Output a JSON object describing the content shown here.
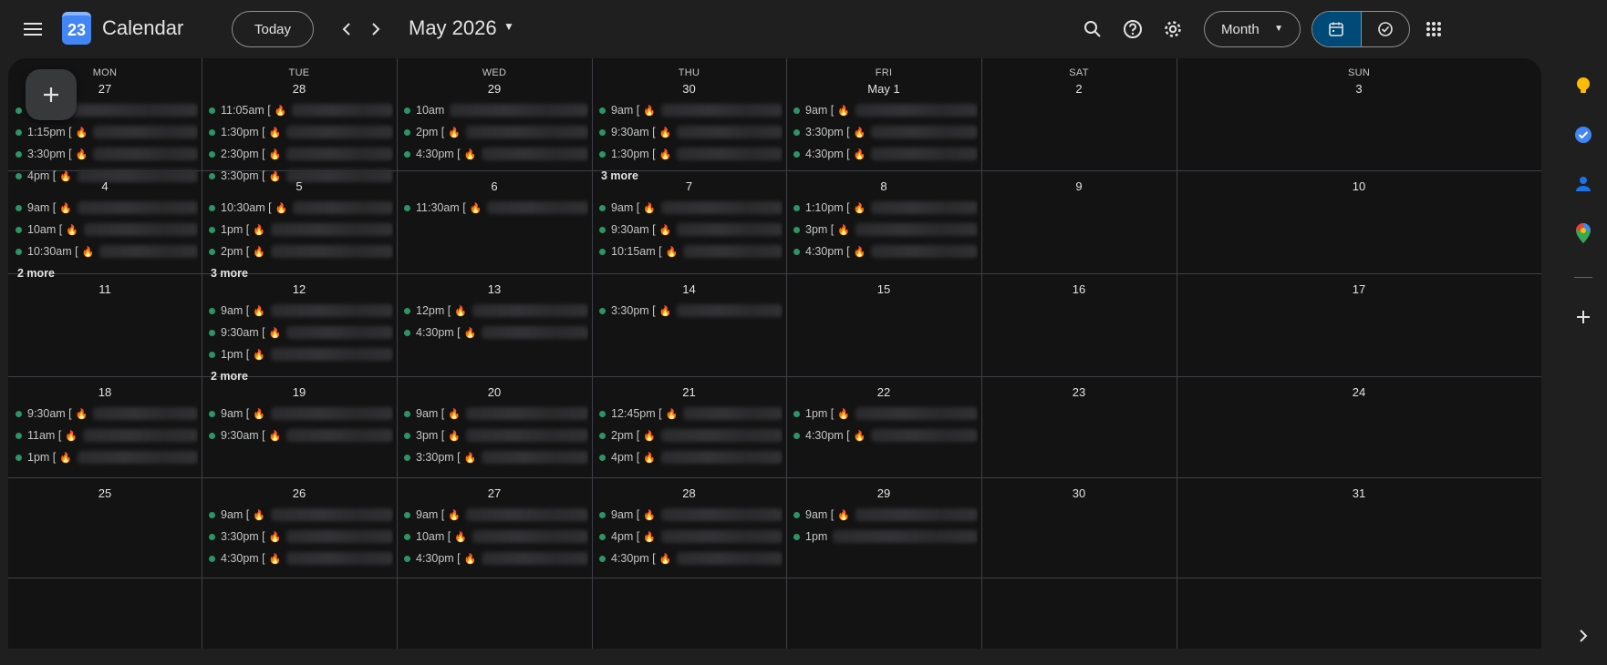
{
  "header": {
    "logo_text": "23",
    "app_title": "Calendar",
    "today_label": "Today",
    "period_title": "May 2026",
    "view_label": "Month"
  },
  "weekday_labels": [
    "MON",
    "TUE",
    "WED",
    "THU",
    "FRI",
    "SAT",
    "SUN"
  ],
  "more_template": "more",
  "weeks": [
    [
      {
        "day": "27",
        "events": [
          {
            "t": ""
          },
          {
            "t": "1:15pm ["
          },
          {
            "t": "3:30pm ["
          },
          {
            "t": "4pm ["
          }
        ],
        "more": ""
      },
      {
        "day": "28",
        "events": [
          {
            "t": "11:05am ["
          },
          {
            "t": "1:30pm ["
          },
          {
            "t": "2:30pm ["
          },
          {
            "t": "3:30pm ["
          }
        ],
        "more": ""
      },
      {
        "day": "29",
        "events": [
          {
            "t": "10am"
          },
          {
            "t": "2pm ["
          },
          {
            "t": "4:30pm ["
          }
        ],
        "more": ""
      },
      {
        "day": "30",
        "events": [
          {
            "t": "9am ["
          },
          {
            "t": "9:30am ["
          },
          {
            "t": "1:30pm ["
          }
        ],
        "more": "3 more"
      },
      {
        "day": "May 1",
        "events": [
          {
            "t": "9am ["
          },
          {
            "t": "3:30pm ["
          },
          {
            "t": "4:30pm ["
          }
        ],
        "more": ""
      },
      {
        "day": "2",
        "events": [],
        "more": ""
      },
      {
        "day": "3",
        "events": [],
        "more": ""
      }
    ],
    [
      {
        "day": "4",
        "events": [
          {
            "t": "9am ["
          },
          {
            "t": "10am ["
          },
          {
            "t": "10:30am ["
          }
        ],
        "more": "2 more"
      },
      {
        "day": "5",
        "events": [
          {
            "t": "10:30am ["
          },
          {
            "t": "1pm ["
          },
          {
            "t": "2pm ["
          }
        ],
        "more": "3 more"
      },
      {
        "day": "6",
        "events": [
          {
            "t": "11:30am ["
          }
        ],
        "more": ""
      },
      {
        "day": "7",
        "events": [
          {
            "t": "9am ["
          },
          {
            "t": "9:30am ["
          },
          {
            "t": "10:15am ["
          }
        ],
        "more": ""
      },
      {
        "day": "8",
        "events": [
          {
            "t": "1:10pm ["
          },
          {
            "t": "3pm ["
          },
          {
            "t": "4:30pm ["
          }
        ],
        "more": ""
      },
      {
        "day": "9",
        "events": [],
        "more": ""
      },
      {
        "day": "10",
        "events": [],
        "more": ""
      }
    ],
    [
      {
        "day": "11",
        "events": [],
        "more": ""
      },
      {
        "day": "12",
        "events": [
          {
            "t": "9am ["
          },
          {
            "t": "9:30am ["
          },
          {
            "t": "1pm ["
          }
        ],
        "more": "2 more"
      },
      {
        "day": "13",
        "events": [
          {
            "t": "12pm ["
          },
          {
            "t": "4:30pm ["
          }
        ],
        "more": ""
      },
      {
        "day": "14",
        "events": [
          {
            "t": "3:30pm ["
          }
        ],
        "more": ""
      },
      {
        "day": "15",
        "events": [],
        "more": ""
      },
      {
        "day": "16",
        "events": [],
        "more": ""
      },
      {
        "day": "17",
        "events": [],
        "more": ""
      }
    ],
    [
      {
        "day": "18",
        "events": [
          {
            "t": "9:30am ["
          },
          {
            "t": "11am ["
          },
          {
            "t": "1pm ["
          }
        ],
        "more": ""
      },
      {
        "day": "19",
        "events": [
          {
            "t": "9am ["
          },
          {
            "t": "9:30am ["
          }
        ],
        "more": ""
      },
      {
        "day": "20",
        "events": [
          {
            "t": "9am ["
          },
          {
            "t": "3pm ["
          },
          {
            "t": "3:30pm ["
          }
        ],
        "more": ""
      },
      {
        "day": "21",
        "events": [
          {
            "t": "12:45pm ["
          },
          {
            "t": "2pm ["
          },
          {
            "t": "4pm ["
          }
        ],
        "more": ""
      },
      {
        "day": "22",
        "events": [
          {
            "t": "1pm ["
          },
          {
            "t": "4:30pm ["
          }
        ],
        "more": ""
      },
      {
        "day": "23",
        "events": [],
        "more": ""
      },
      {
        "day": "24",
        "events": [],
        "more": ""
      }
    ],
    [
      {
        "day": "25",
        "events": [],
        "more": ""
      },
      {
        "day": "26",
        "events": [
          {
            "t": "9am ["
          },
          {
            "t": "3:30pm ["
          },
          {
            "t": "4:30pm ["
          }
        ],
        "more": ""
      },
      {
        "day": "27",
        "events": [
          {
            "t": "9am ["
          },
          {
            "t": "10am ["
          },
          {
            "t": "4:30pm ["
          }
        ],
        "more": ""
      },
      {
        "day": "28",
        "events": [
          {
            "t": "9am ["
          },
          {
            "t": "4pm ["
          },
          {
            "t": "4:30pm ["
          }
        ],
        "more": ""
      },
      {
        "day": "29",
        "events": [
          {
            "t": "9am ["
          },
          {
            "t": "1pm"
          }
        ],
        "more": ""
      },
      {
        "day": "30",
        "events": [],
        "more": ""
      },
      {
        "day": "31",
        "events": [],
        "more": ""
      }
    ]
  ],
  "side_panel": [
    {
      "name": "keep-icon",
      "color": "#fbbc04"
    },
    {
      "name": "tasks-icon",
      "color": "#4285f4"
    },
    {
      "name": "contacts-icon",
      "color": "#1a73e8"
    },
    {
      "name": "maps-icon",
      "color": "#34a853"
    }
  ],
  "colors": {
    "accent": "#004a77",
    "event_dot": "#33b679",
    "background": "#1f1f1f",
    "grid_background": "#131314"
  }
}
